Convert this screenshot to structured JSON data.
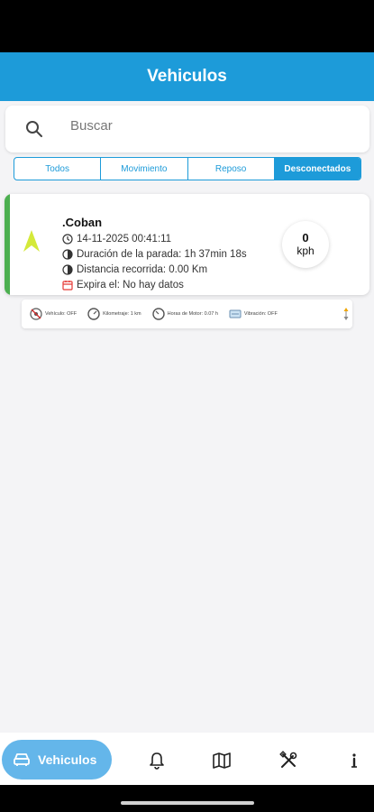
{
  "app_bar": {
    "title": "Vehiculos"
  },
  "search": {
    "placeholder": "Buscar",
    "icon": "search-icon"
  },
  "filters": [
    {
      "label": "Todos",
      "active": false
    },
    {
      "label": "Movimiento",
      "active": false
    },
    {
      "label": "Reposo",
      "active": false
    },
    {
      "label": "Desconectados",
      "active": true
    }
  ],
  "vehicle": {
    "name": ".Coban",
    "timestamp": "14-11-2025 00:41:11",
    "stop_duration": "Duración de la parada: 1h 37min 18s",
    "distance": "Distancia recorrida: 0.00 Km",
    "expires": "Expira el: No hay datos",
    "speed_value": "0",
    "speed_unit": "kph",
    "status_color": "#4caf50",
    "arrow_color": "#d4e93a"
  },
  "sensors": [
    {
      "label": "Vehículo: OFF",
      "icon": "engine-icon"
    },
    {
      "label": "Kilometraje: 1 km",
      "icon": "odometer-icon"
    },
    {
      "label": "Horas de Motor: 0.07 h",
      "icon": "engine-hours-icon"
    },
    {
      "label": "Vibración: OFF",
      "icon": "vibration-icon"
    }
  ],
  "bottom_nav": {
    "active_label": "Vehiculos",
    "items": [
      "car-icon",
      "bell-icon",
      "map-icon",
      "tools-icon",
      "info-icon"
    ]
  },
  "colors": {
    "primary": "#1d9bd9",
    "nav_active": "#64b6ea"
  }
}
